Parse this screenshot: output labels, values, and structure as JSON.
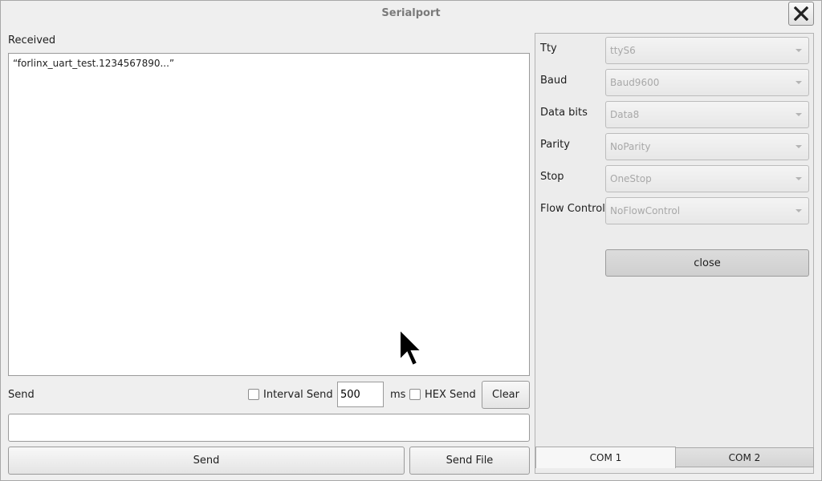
{
  "window": {
    "title": "Serialport",
    "close_label": "X"
  },
  "received": {
    "label": "Received",
    "text": "“forlinx_uart_test.1234567890...”"
  },
  "send_controls": {
    "label": "Send",
    "interval_send_label": "Interval Send",
    "interval_value": "500",
    "interval_unit": "ms",
    "hex_send_label": "HEX Send",
    "clear_label": "Clear",
    "send_value": "",
    "send_button_label": "Send",
    "send_file_label": "Send File"
  },
  "settings": {
    "tty": {
      "label": "Tty",
      "value": "ttyS6"
    },
    "baud": {
      "label": "Baud",
      "value": "Baud9600"
    },
    "data_bits": {
      "label": "Data bits",
      "value": "Data8"
    },
    "parity": {
      "label": "Parity",
      "value": "NoParity"
    },
    "stop": {
      "label": "Stop",
      "value": "OneStop"
    },
    "flow_control": {
      "label": "Flow Control",
      "value": "NoFlowControl"
    },
    "close_button_label": "close"
  },
  "tabs": [
    {
      "label": "COM 1",
      "active": true
    },
    {
      "label": "COM 2",
      "active": false
    }
  ]
}
